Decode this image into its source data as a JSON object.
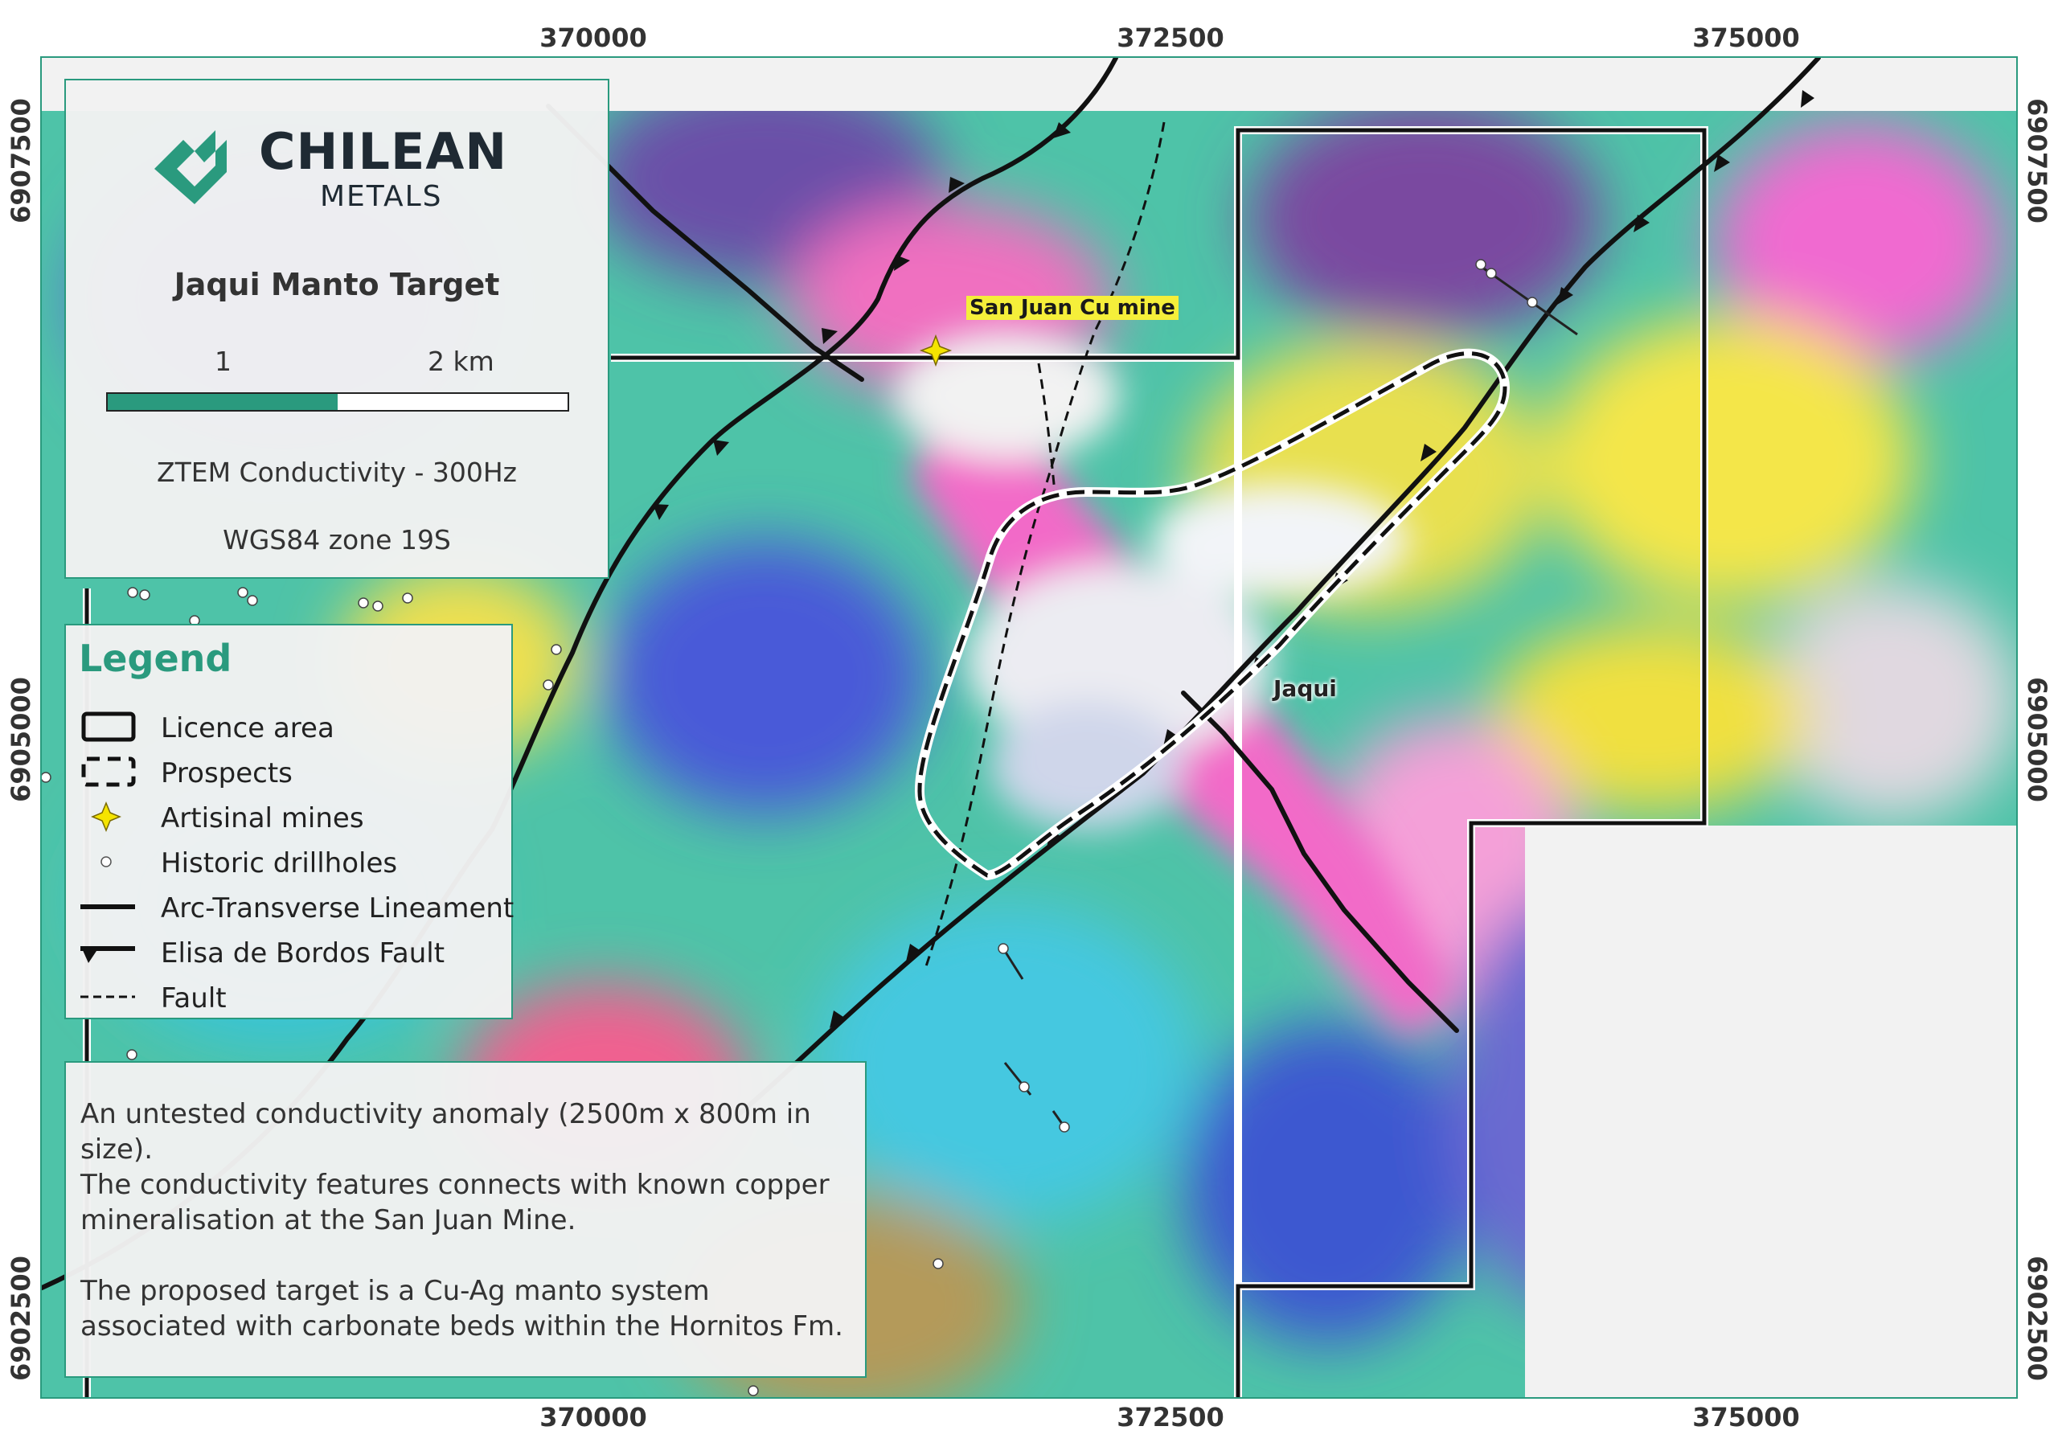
{
  "logo": {
    "line1": "CHILEAN",
    "line2": "METALS",
    "icon": "chilean-metals-chevron-logo"
  },
  "title": "Jaqui Manto Target",
  "scale": {
    "label_mid": "1",
    "label_end": "2 km",
    "fill_fraction": 0.5
  },
  "layer_name": "ZTEM Conductivity - 300Hz",
  "crs": "WGS84 zone 19S",
  "legend": {
    "title": "Legend",
    "items": [
      {
        "label": "Licence area",
        "symbol": "solid-rectangle"
      },
      {
        "label": "Prospects",
        "symbol": "dashed-rectangle"
      },
      {
        "label": "Artisinal mines",
        "symbol": "yellow-star"
      },
      {
        "label": "Historic drillholes",
        "symbol": "white-circle"
      },
      {
        "label": "Arc-Transverse Lineament",
        "symbol": "thick-line"
      },
      {
        "label": "Elisa de Bordos Fault",
        "symbol": "line-with-triangles"
      },
      {
        "label": "Fault",
        "symbol": "dashed-line"
      }
    ]
  },
  "notes": [
    "An untested conductivity anomaly (2500m x 800m in size).",
    "The conductivity features connects with known copper mineralisation at the San Juan Mine.",
    "The proposed target is a Cu-Ag manto system associated with carbonate beds within the Hornitos Fm."
  ],
  "map_labels": {
    "mine": "San Juan Cu mine",
    "prospect": "Jaqui"
  },
  "axes": {
    "easting": [
      "370000",
      "372500",
      "375000"
    ],
    "northing": [
      "6907500",
      "6905000",
      "6902500"
    ]
  },
  "colors": {
    "accent": "#2a9a7e",
    "mine_label_bg": "#f5ef3a",
    "star": "#f5e400"
  }
}
